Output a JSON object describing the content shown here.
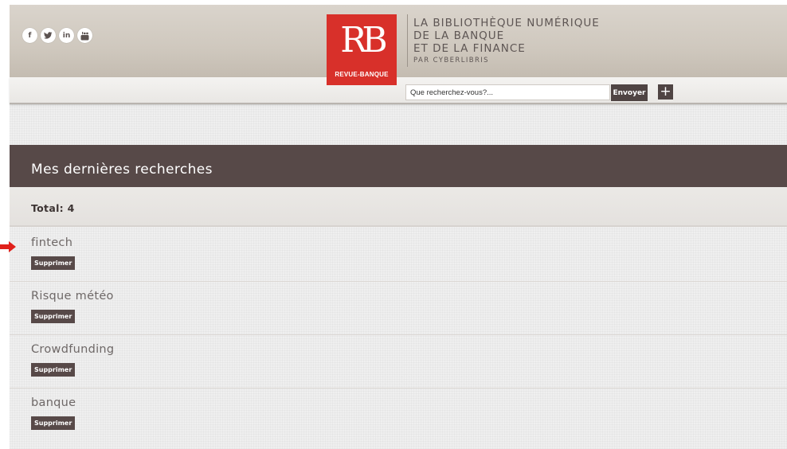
{
  "header": {
    "social_icons": [
      {
        "name": "facebook-icon",
        "glyph": "f"
      },
      {
        "name": "twitter-icon",
        "glyph": ""
      },
      {
        "name": "linkedin-icon",
        "glyph": "in"
      },
      {
        "name": "youtube-icon",
        "glyph": "You"
      }
    ],
    "logo": {
      "mark": "RB",
      "text": "REVUE-BANQUE"
    },
    "tagline": {
      "line1": "LA BIBLIOTHÈQUE NUMÉRIQUE",
      "line2": "DE LA BANQUE",
      "line3": "ET DE LA FINANCE",
      "sub": "PAR CYBERLIBRIS"
    },
    "search": {
      "placeholder": "Que recherchez-vous?...",
      "submit_label": "Envoyer",
      "plus_label": "+"
    }
  },
  "main": {
    "title": "Mes dernières recherches",
    "total": "Total: 4",
    "delete_label": "Supprimer",
    "items": [
      {
        "label": "fintech"
      },
      {
        "label": "Risque météo"
      },
      {
        "label": "Crowdfunding"
      },
      {
        "label": "banque"
      }
    ]
  },
  "colors": {
    "brand_red": "#d8302a",
    "dark_brown": "#574948",
    "arrow_red": "#e0201a"
  }
}
